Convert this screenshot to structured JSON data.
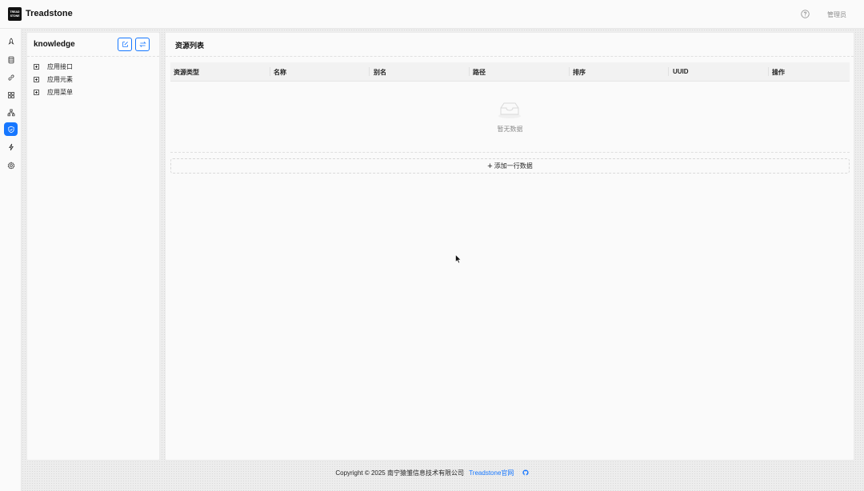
{
  "app": {
    "logo_line1": "TREAD",
    "logo_line2": "STONE",
    "title": "Treadstone",
    "user": "管理员"
  },
  "rail": {
    "items": [
      {
        "icon": "rocket-icon"
      },
      {
        "icon": "database-icon"
      },
      {
        "icon": "link-icon"
      },
      {
        "icon": "apps-icon"
      },
      {
        "icon": "org-tree-icon"
      },
      {
        "icon": "shield-icon",
        "active": true
      },
      {
        "icon": "lightning-icon"
      },
      {
        "icon": "gear-icon"
      }
    ]
  },
  "tree": {
    "title": "knowledge",
    "actions": [
      {
        "icon": "edit-icon"
      },
      {
        "icon": "swap-icon"
      }
    ],
    "items": [
      {
        "label": "应用接口"
      },
      {
        "label": "应用元素"
      },
      {
        "label": "应用菜单"
      }
    ]
  },
  "main": {
    "title": "资源列表",
    "columns": [
      "资源类型",
      "名称",
      "别名",
      "路径",
      "排序",
      "UUID",
      "操作"
    ],
    "empty_text": "暂无数据",
    "add_row_label": "添加一行数据"
  },
  "footer": {
    "copyright": "Copyright © 2025 南宁猿雏信息技术有限公司",
    "link": "Treadstone官网"
  },
  "colors": {
    "accent": "#1677ff",
    "header_bg": "#fafafa",
    "page_bg": "#ededed"
  }
}
